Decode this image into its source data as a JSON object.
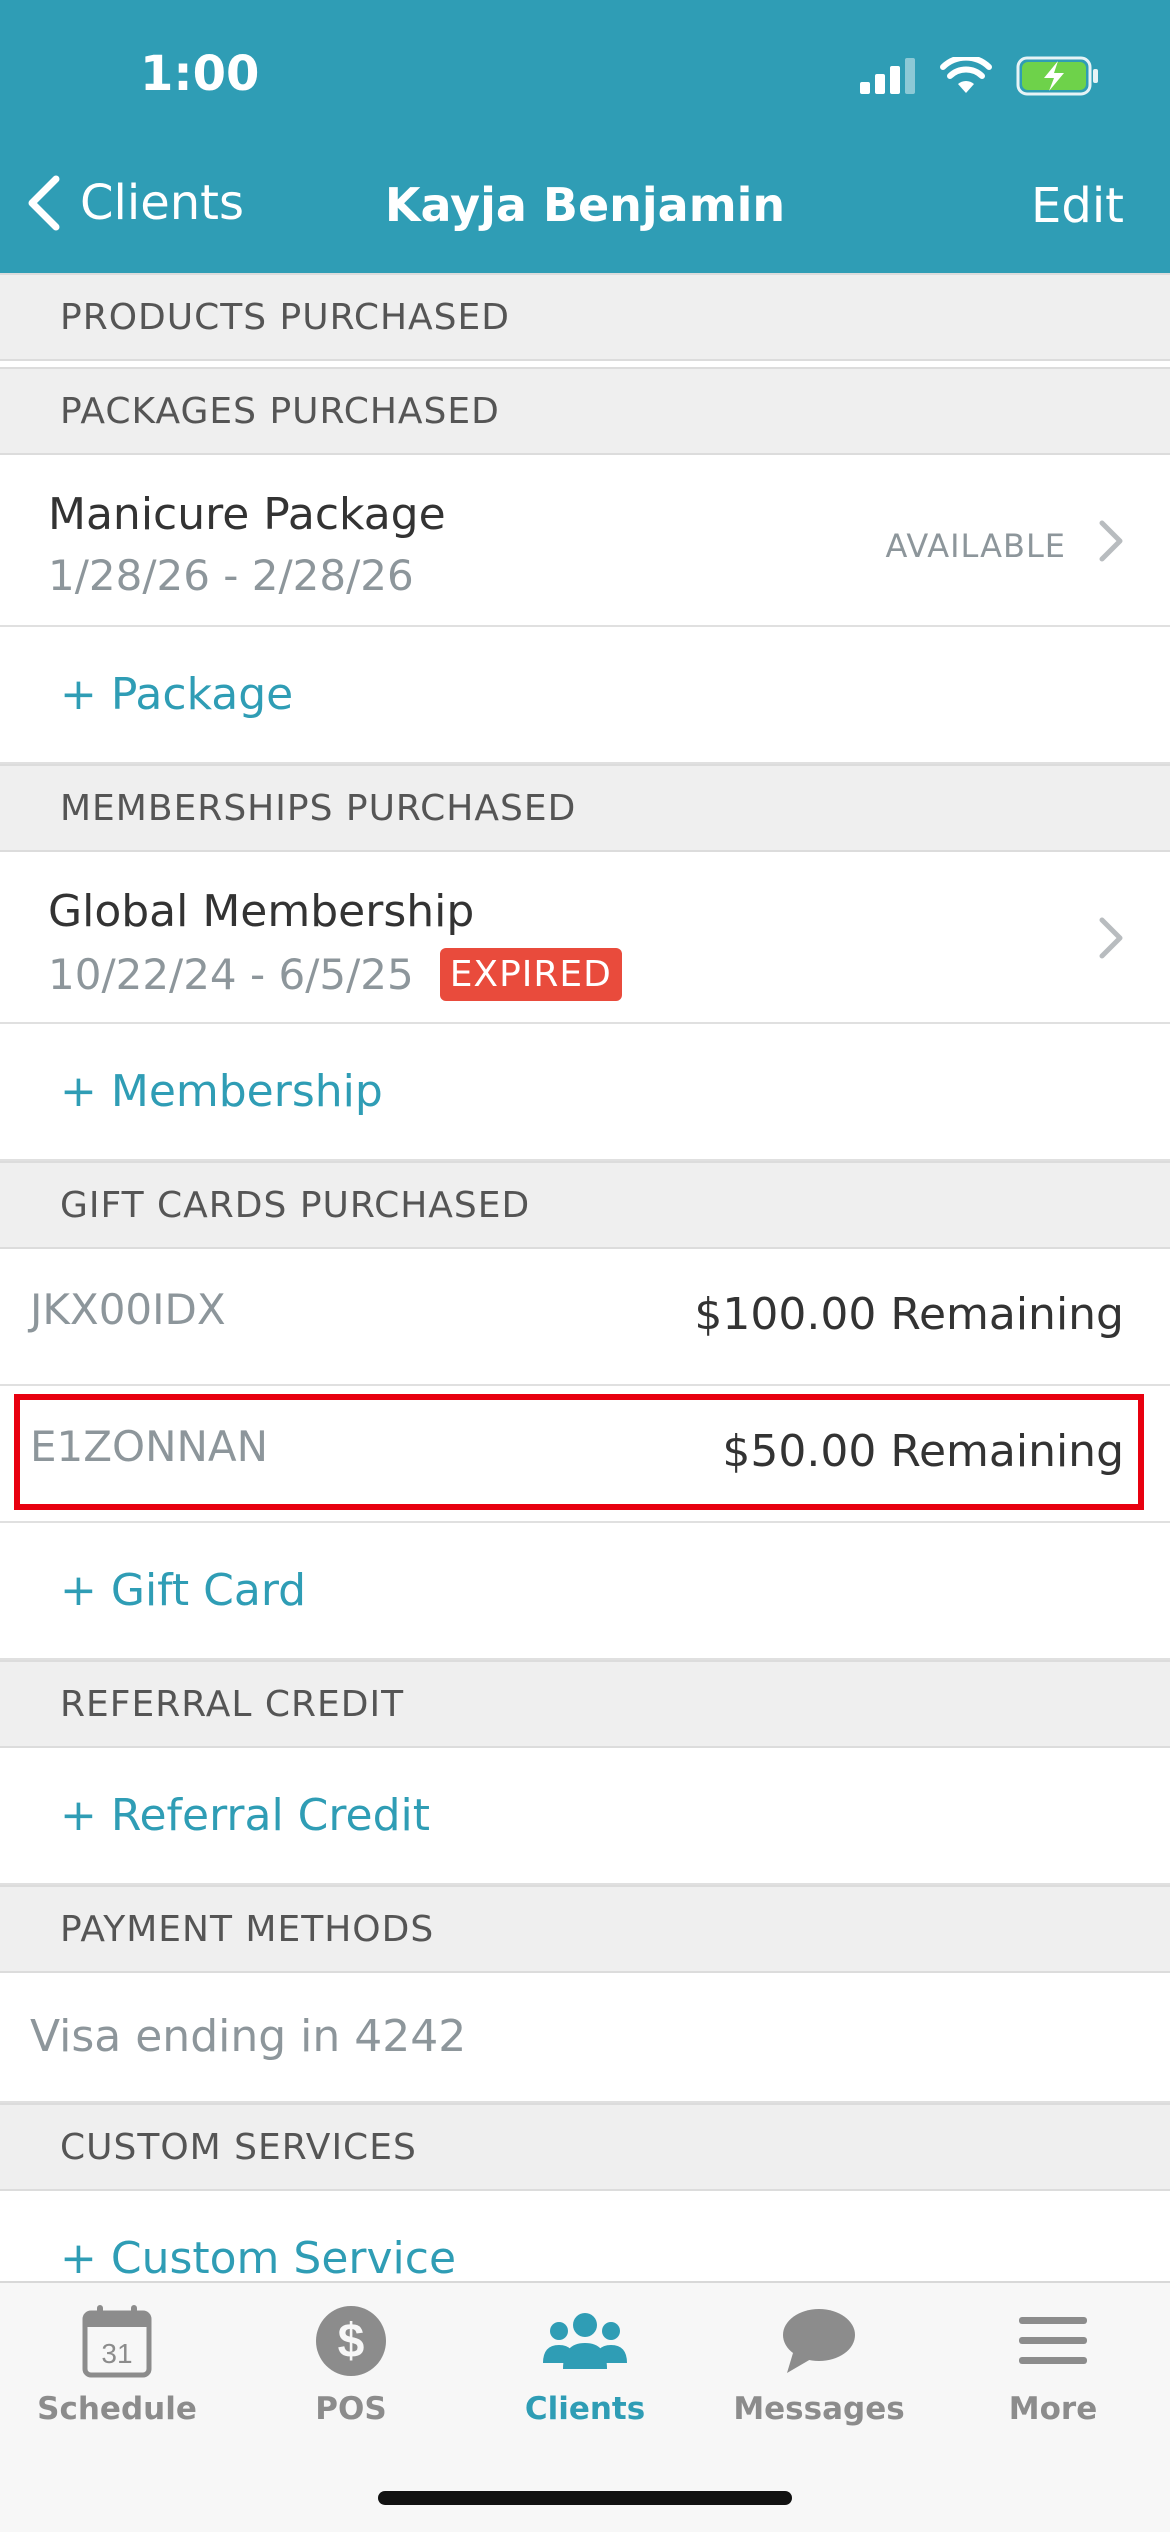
{
  "status_bar": {
    "time": "1:00"
  },
  "nav": {
    "back_label": "Clients",
    "title": "Kayja Benjamin",
    "edit_label": "Edit"
  },
  "sections": {
    "products": "PRODUCTS PURCHASED",
    "packages": "PACKAGES PURCHASED",
    "memberships": "MEMBERSHIPS PURCHASED",
    "gift_cards": "GIFT CARDS PURCHASED",
    "referral": "REFERRAL CREDIT",
    "payment": "PAYMENT METHODS",
    "custom": "CUSTOM SERVICES"
  },
  "package": {
    "name": "Manicure Package",
    "dates": "1/28/26 - 2/28/26",
    "status": "AVAILABLE"
  },
  "add_package": "+ Package",
  "membership": {
    "name": "Global Membership",
    "dates": "10/22/24 - 6/5/25",
    "badge": "EXPIRED"
  },
  "add_membership": "+ Membership",
  "gift_cards": [
    {
      "code": "JKX00IDX",
      "amount": "$100.00 Remaining"
    },
    {
      "code": "E1ZONNAN",
      "amount": "$50.00 Remaining"
    }
  ],
  "add_gift_card": "+ Gift Card",
  "add_referral": "+ Referral Credit",
  "payment_method": "Visa ending in 4242",
  "add_custom_service": "+ Custom Service",
  "calendar_day": "31",
  "tabs": [
    {
      "label": "Schedule",
      "icon": "calendar-icon"
    },
    {
      "label": "POS",
      "icon": "dollar-icon"
    },
    {
      "label": "Clients",
      "icon": "clients-icon"
    },
    {
      "label": "Messages",
      "icon": "chat-icon"
    },
    {
      "label": "More",
      "icon": "menu-icon"
    }
  ],
  "colors": {
    "accent": "#2f9db5",
    "expired": "#e94b3c",
    "highlight": "#e8000f"
  }
}
